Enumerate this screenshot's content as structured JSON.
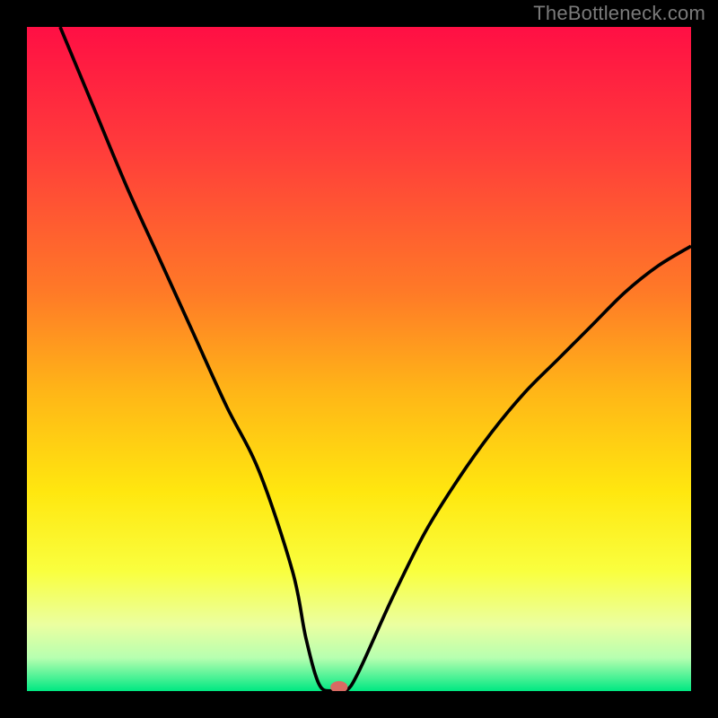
{
  "watermark": "TheBottleneck.com",
  "chart_data": {
    "type": "line",
    "title": "",
    "xlabel": "",
    "ylabel": "",
    "xlim": [
      0,
      100
    ],
    "ylim": [
      0,
      100
    ],
    "grid": false,
    "legend": false,
    "annotations": [],
    "series": [
      {
        "name": "curve",
        "x": [
          5,
          10,
          15,
          20,
          25,
          30,
          35,
          40,
          42,
          44,
          46,
          48,
          50,
          55,
          60,
          65,
          70,
          75,
          80,
          85,
          90,
          95,
          100
        ],
        "y": [
          100,
          88,
          76,
          65,
          54,
          43,
          33,
          18,
          8,
          1,
          0,
          0,
          3,
          14,
          24,
          32,
          39,
          45,
          50,
          55,
          60,
          64,
          67
        ]
      }
    ],
    "marker": {
      "x": 47,
      "y": 0
    },
    "background_gradient": {
      "stops": [
        {
          "pos": 0.0,
          "color": "#ff0f44"
        },
        {
          "pos": 0.18,
          "color": "#ff3b3b"
        },
        {
          "pos": 0.4,
          "color": "#ff7a27"
        },
        {
          "pos": 0.55,
          "color": "#ffb617"
        },
        {
          "pos": 0.7,
          "color": "#ffe70f"
        },
        {
          "pos": 0.82,
          "color": "#f9ff3f"
        },
        {
          "pos": 0.9,
          "color": "#ebffa0"
        },
        {
          "pos": 0.95,
          "color": "#b7ffb0"
        },
        {
          "pos": 1.0,
          "color": "#00e882"
        }
      ]
    }
  }
}
